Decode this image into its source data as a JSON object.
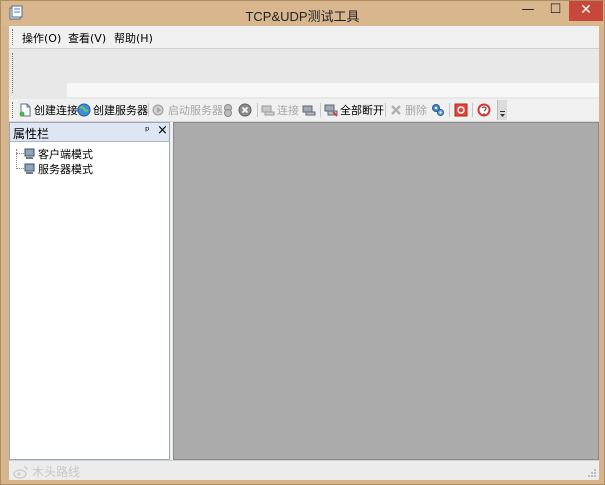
{
  "window": {
    "title": "TCP&UDP测试工具",
    "min_glyph": "—",
    "max_glyph": "☐",
    "close_glyph": "✕"
  },
  "menu": {
    "items": [
      {
        "label": "操作(O)"
      },
      {
        "label": "查看(V)"
      },
      {
        "label": "帮助(H)"
      }
    ]
  },
  "toolbar": {
    "create_connection": "创建连接",
    "create_server": "创建服务器",
    "start_server": "启动服务器",
    "connect": "连接",
    "disconnect_all": "全部断开",
    "delete": "删除"
  },
  "panel": {
    "title": "属性栏",
    "pin_glyph": "ᵖ",
    "close_glyph": "×",
    "tree": [
      {
        "label": "客户端模式"
      },
      {
        "label": "服务器模式"
      }
    ]
  },
  "status": {
    "watermark": "木头路线"
  },
  "colors": {
    "titlebar": "#d8b78f",
    "close_button": "#c7473b",
    "workspace": "#ababab",
    "panel_header": "#dde6f2"
  }
}
